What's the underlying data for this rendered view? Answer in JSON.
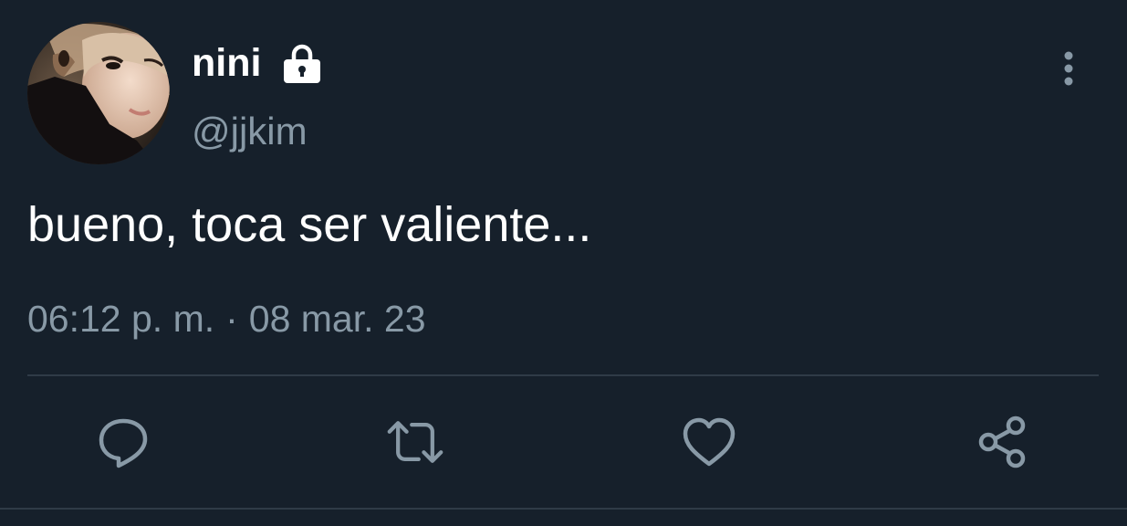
{
  "tweet": {
    "display_name": "nini",
    "handle": "@jjkim",
    "text": "bueno, toca ser valiente...",
    "time": "06:12 p. m.",
    "separator": "·",
    "date": "08 mar. 23",
    "protected": true
  },
  "icons": {
    "lock": "lock-icon",
    "more": "more-vertical-icon",
    "reply": "reply-icon",
    "retweet": "retweet-icon",
    "like": "heart-icon",
    "share": "share-icon"
  },
  "colors": {
    "background": "#16202b",
    "primary_text": "#ffffff",
    "secondary_text": "#8899a6",
    "divider": "#2f3b47"
  }
}
